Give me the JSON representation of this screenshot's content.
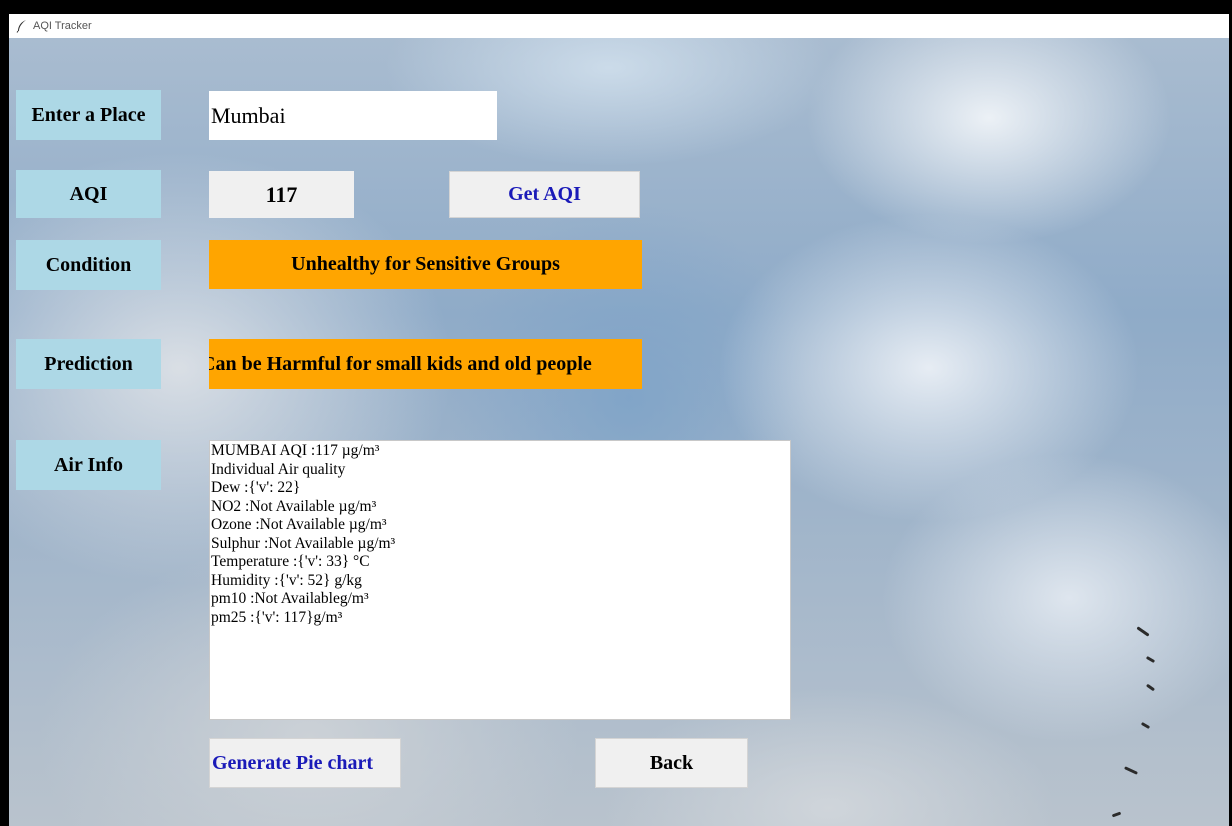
{
  "window": {
    "title": "AQI Tracker",
    "icon": "feather-icon"
  },
  "labels": {
    "place": "Enter a Place",
    "aqi": "AQI",
    "condition": "Condition",
    "prediction": "Prediction",
    "air_info": "Air Info"
  },
  "place_input": {
    "value": "Mumbai"
  },
  "aqi": {
    "value": "117",
    "get_button": "Get AQI"
  },
  "condition": {
    "text": "Unhealthy for Sensitive Groups",
    "color": "#ffa500"
  },
  "prediction": {
    "text": "Can be Harmful for small kids and old people",
    "color": "#ffa500"
  },
  "air_info": {
    "lines": [
      "MUMBAI  AQI :117 µg/m³",
      "Individual Air quality",
      "Dew :{'v': 22}",
      "NO2 :Not Available µg/m³",
      "Ozone :Not Available µg/m³",
      "Sulphur :Not Available µg/m³",
      "Temperature :{'v': 33} °C",
      "Humidity :{'v': 52} g/kg",
      "pm10 :Not Availableg/m³",
      "pm25 :{'v': 117}g/m³"
    ]
  },
  "buttons": {
    "pie_chart": "Generate Pie chart",
    "back": "Back"
  },
  "colors": {
    "label_bg": "#add8e6",
    "accent_text": "#1a1ab8"
  }
}
